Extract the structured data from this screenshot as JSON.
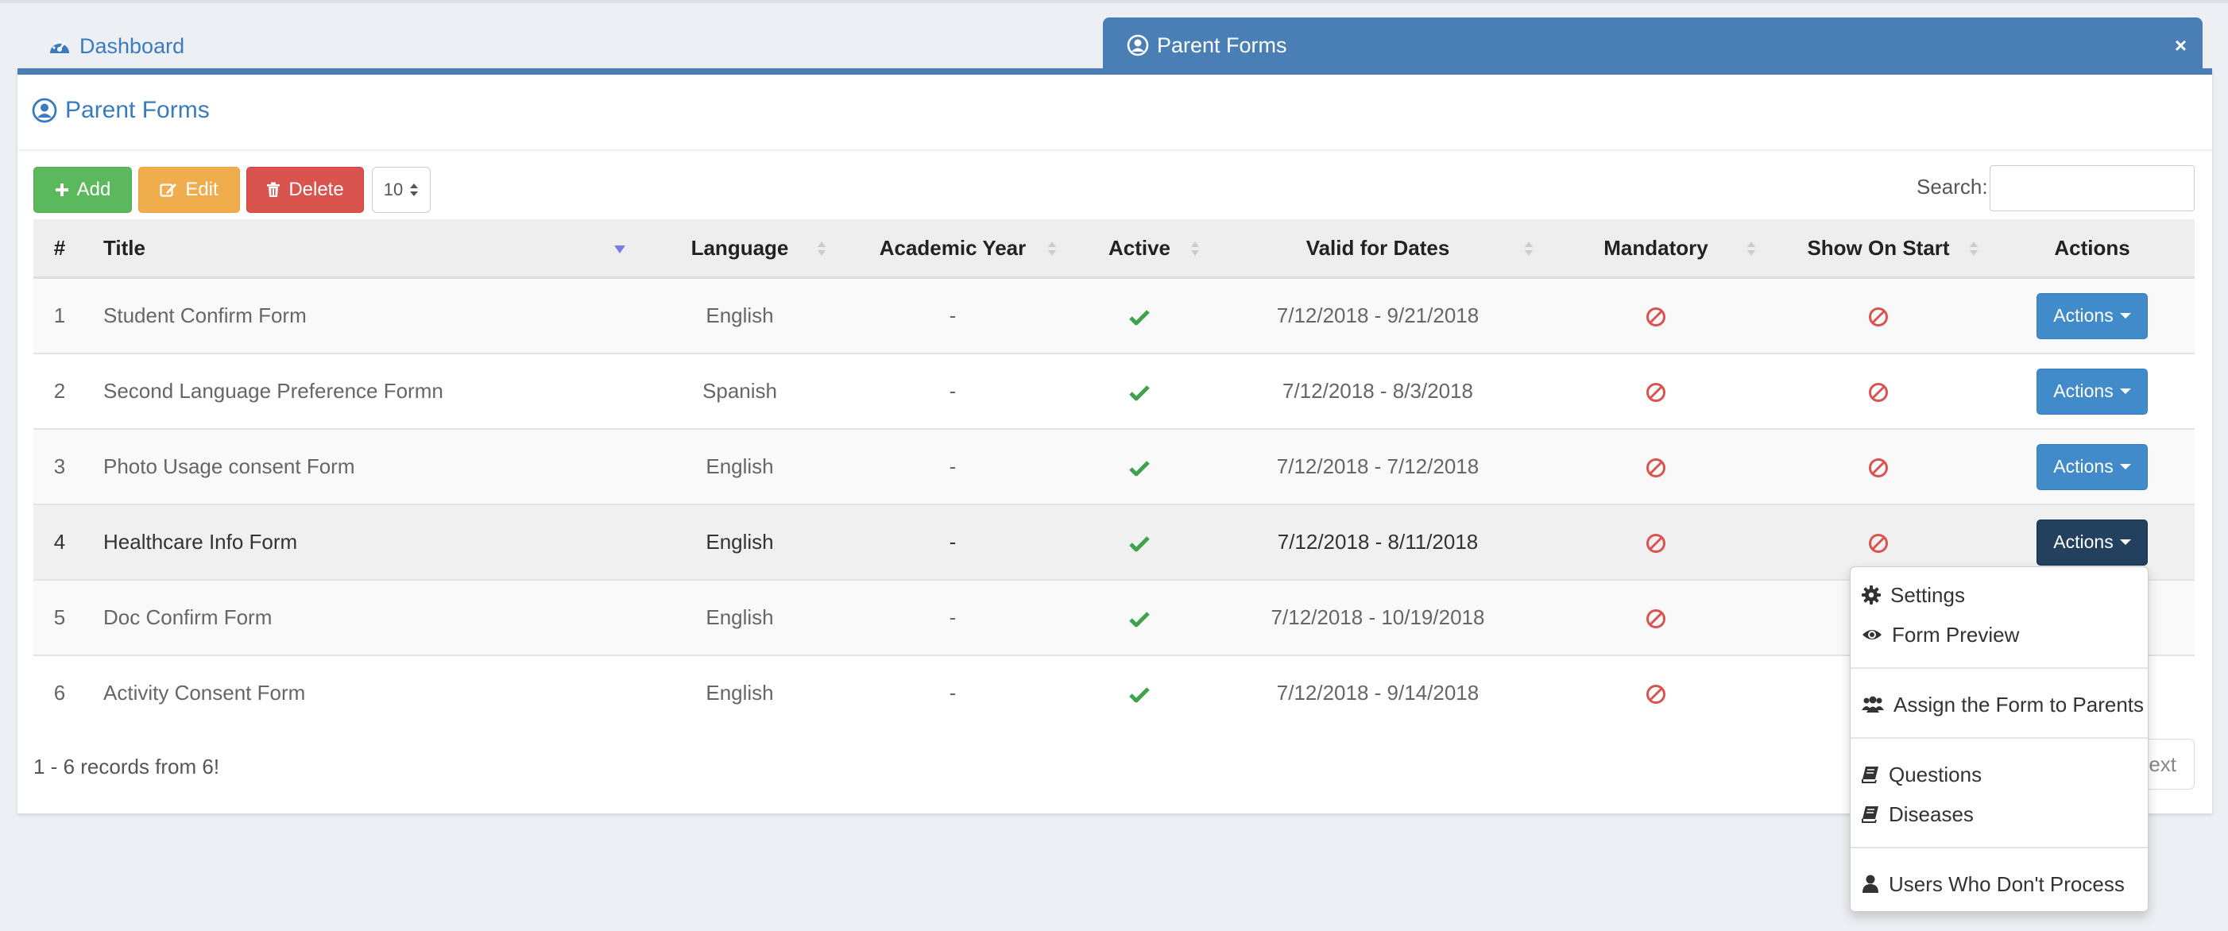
{
  "tabs": {
    "dashboard": "Dashboard",
    "active": "Parent Forms",
    "close": "×"
  },
  "panel": {
    "title": "Parent Forms"
  },
  "toolbar": {
    "add": "Add",
    "edit": "Edit",
    "delete": "Delete",
    "page_size": "10",
    "search_label": "Search:",
    "search_value": ""
  },
  "table": {
    "headers": {
      "num": "#",
      "title": "Title",
      "language": "Language",
      "academic_year": "Academic Year",
      "active": "Active",
      "valid_dates": "Valid for Dates",
      "mandatory": "Mandatory",
      "show_on_start": "Show On Start",
      "actions": "Actions"
    },
    "rows": [
      {
        "num": "1",
        "title": "Student Confirm Form",
        "language": "English",
        "academic_year": "-",
        "active": true,
        "dates": "7/12/2018 - 9/21/2018",
        "mandatory": false,
        "show_on_start": false,
        "actions": "Actions"
      },
      {
        "num": "2",
        "title": "Second Language Preference Formn",
        "language": "Spanish",
        "academic_year": "-",
        "active": true,
        "dates": "7/12/2018 - 8/3/2018",
        "mandatory": false,
        "show_on_start": false,
        "actions": "Actions"
      },
      {
        "num": "3",
        "title": "Photo Usage consent Form",
        "language": "English",
        "academic_year": "-",
        "active": true,
        "dates": "7/12/2018 - 7/12/2018",
        "mandatory": false,
        "show_on_start": false,
        "actions": "Actions"
      },
      {
        "num": "4",
        "title": "Healthcare Info Form",
        "language": "English",
        "academic_year": "-",
        "active": true,
        "dates": "7/12/2018 - 8/11/2018",
        "mandatory": false,
        "show_on_start": false,
        "actions": "Actions"
      },
      {
        "num": "5",
        "title": "Doc Confirm Form",
        "language": "English",
        "academic_year": "-",
        "active": true,
        "dates": "7/12/2018 - 10/19/2018",
        "mandatory": false
      },
      {
        "num": "6",
        "title": "Activity Consent Form",
        "language": "English",
        "academic_year": "-",
        "active": true,
        "dates": "7/12/2018 - 9/14/2018",
        "mandatory": false
      }
    ]
  },
  "footer": {
    "records": "1 - 6 records from 6!",
    "next": "ext"
  },
  "dropdown": {
    "settings": "Settings",
    "form_preview": "Form Preview",
    "assign": "Assign the Form to Parents",
    "questions": "Questions",
    "diseases": "Diseases",
    "users": "Users Who Don't Process"
  },
  "colors": {
    "primary": "#4a7fb5",
    "success": "#5cb85c",
    "warning": "#f0ad4e",
    "danger": "#d9534f",
    "action": "#428bca",
    "action_active": "#23405f",
    "check": "#3fa34d",
    "ban": "#d9534f"
  },
  "icons": {
    "dashboard": "tachometer-icon",
    "tab": "user-circle-icon",
    "add": "plus-icon",
    "edit": "edit-icon",
    "delete": "trash-icon",
    "active_true": "check-icon",
    "flag_false": "ban-icon"
  }
}
